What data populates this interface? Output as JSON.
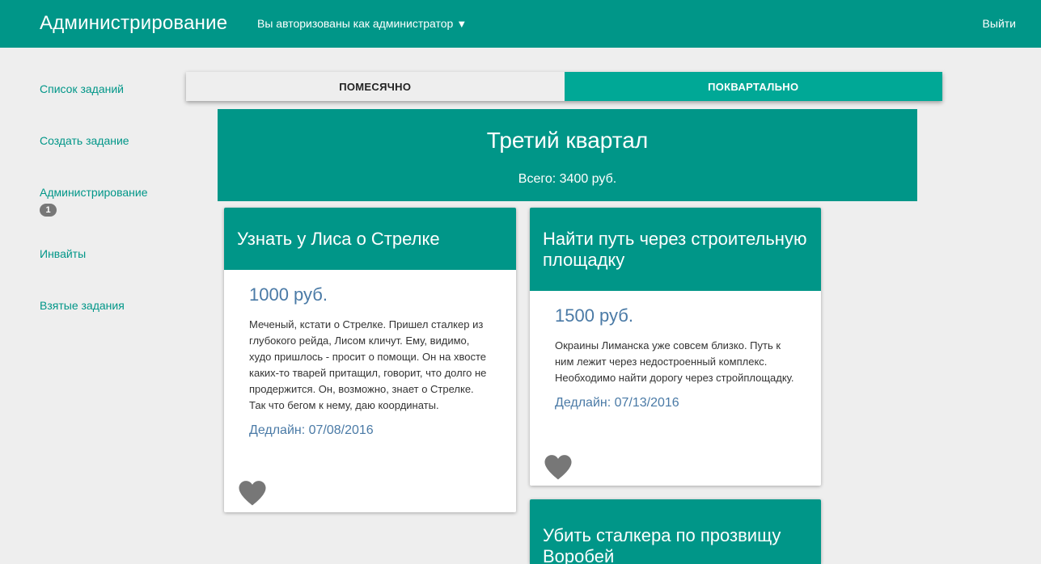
{
  "navbar": {
    "brand": "Администрирование",
    "user_menu": "Вы авторизованы как администратор",
    "caret": "▼",
    "logout": "Выйти"
  },
  "sidebar": {
    "items": [
      {
        "label": "Список заданий"
      },
      {
        "label": "Создать задание"
      },
      {
        "label": "Администрирование",
        "badge": "1"
      },
      {
        "label": "Инвайты"
      },
      {
        "label": "Взятые задания"
      }
    ]
  },
  "tabs": {
    "monthly": "ПОМЕСЯЧНО",
    "quarterly": "ПОКВАРТАЛЬНО",
    "active": "quarterly"
  },
  "quarter": {
    "title": "Третий квартал",
    "total": "Всего: 3400 руб."
  },
  "cards": [
    {
      "title": "Узнать у Лиса о Стрелке",
      "price": "1000 руб.",
      "description": "Меченый, кстати о Стрелке. Пришел сталкер из глубокого рейда, Лисом кличут. Ему, видимо, худо пришлось - просит о помощи. Он на хвосте каких-то тварей притащил, говорит, что долго не продержится. Он, возможно, знает о Стрелке. Так что бегом к нему, даю координаты.",
      "deadline": "Дедлайн: 07/08/2016"
    },
    {
      "title": "Найти путь через строительную площадку",
      "price": "1500 руб.",
      "description": "Окраины Лиманска уже совсем близко. Путь к ним лежит через недостроенный комплекс. Необходимо найти дорогу через стройплощадку.",
      "deadline": "Дедлайн: 07/13/2016"
    },
    {
      "title": "Убить сталкера по прозвищу Воробей"
    }
  ],
  "colors": {
    "primary": "#009688",
    "tab_active": "#00a896",
    "link_blue": "#4a7aa6",
    "heart": "#777777"
  }
}
